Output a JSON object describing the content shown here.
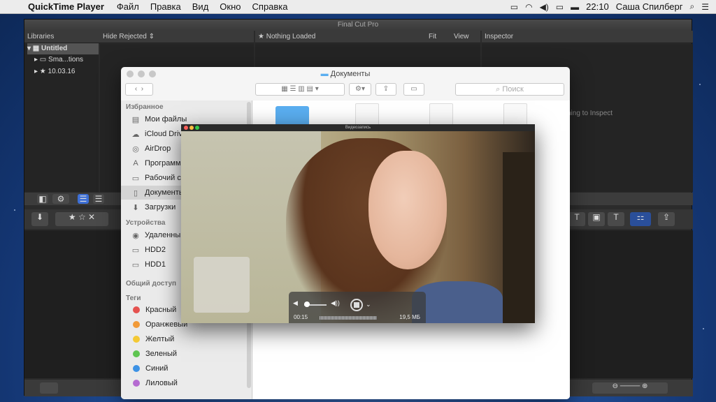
{
  "menubar": {
    "app_name": "QuickTime Player",
    "menus": [
      "Файл",
      "Правка",
      "Вид",
      "Окно",
      "Справка"
    ],
    "time": "22:10",
    "user": "Саша Спилберг"
  },
  "fcp": {
    "title": "Final Cut Pro",
    "libraries_label": "Libraries",
    "filter_label": "Hide Rejected",
    "viewer_label": "Nothing Loaded",
    "fit_label": "Fit",
    "view_label": "View",
    "inspector_label": "Inspector",
    "inspector_text": "ning to Inspect",
    "library_items": [
      "Untitled",
      "Sma...tions",
      "10.03.16"
    ]
  },
  "finder": {
    "title": "Документы",
    "search_placeholder": "Поиск",
    "sections": {
      "favorites": "Избранное",
      "devices": "Устройства",
      "shared": "Общий доступ",
      "tags": "Теги"
    },
    "favorites": [
      "Мои файлы",
      "iCloud Drive",
      "AirDrop",
      "Программы",
      "Рабочий стол",
      "Документы",
      "Загрузки"
    ],
    "devices": [
      "Удаленный диск",
      "HDD2",
      "HDD1"
    ],
    "tags": [
      {
        "label": "Красный",
        "color": "#e5524f"
      },
      {
        "label": "Оранжевый",
        "color": "#f19a38"
      },
      {
        "label": "Желтый",
        "color": "#f4c935"
      },
      {
        "label": "Зеленый",
        "color": "#5fc551"
      },
      {
        "label": "Синий",
        "color": "#3d92e5"
      },
      {
        "label": "Лиловый",
        "color": "#b56bd1"
      }
    ]
  },
  "quicktime": {
    "title": "Видеозапись",
    "elapsed": "00:15",
    "file_size": "19,5 МБ"
  }
}
